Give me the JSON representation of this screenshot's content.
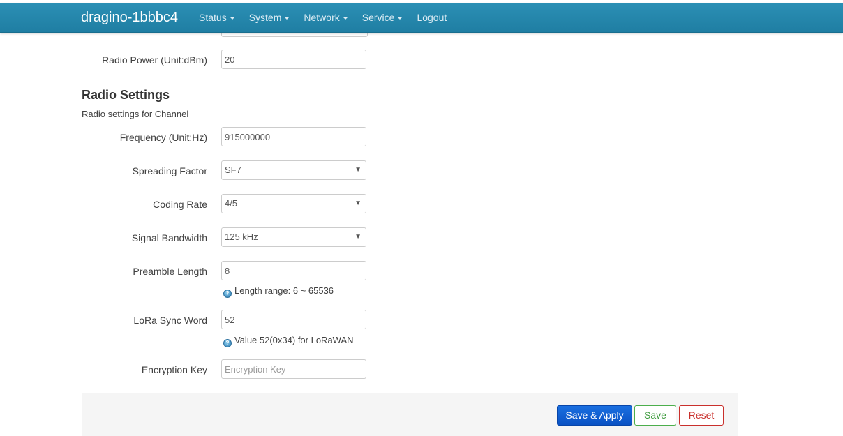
{
  "nav": {
    "brand": "dragino-1bbbc4",
    "menu": [
      {
        "label": "Status",
        "dropdown": true
      },
      {
        "label": "System",
        "dropdown": true
      },
      {
        "label": "Network",
        "dropdown": true
      },
      {
        "label": "Service",
        "dropdown": true
      },
      {
        "label": "Logout",
        "dropdown": false
      }
    ]
  },
  "radio_power": {
    "label": "Radio Power (Unit:dBm)",
    "value": "20"
  },
  "section": {
    "title": "Radio Settings",
    "description": "Radio settings for Channel"
  },
  "fields": {
    "frequency": {
      "label": "Frequency (Unit:Hz)",
      "value": "915000000"
    },
    "spreading_factor": {
      "label": "Spreading Factor",
      "selected": "SF7"
    },
    "coding_rate": {
      "label": "Coding Rate",
      "selected": "4/5"
    },
    "signal_bandwidth": {
      "label": "Signal Bandwidth",
      "selected": "125 kHz"
    },
    "preamble_length": {
      "label": "Preamble Length",
      "value": "8",
      "hint": "Length range: 6 ~ 65536"
    },
    "sync_word": {
      "label": "LoRa Sync Word",
      "value": "52",
      "hint": "Value 52(0x34) for LoRaWAN"
    },
    "encryption_key": {
      "label": "Encryption Key",
      "value": "",
      "placeholder": "Encryption Key"
    }
  },
  "actions": {
    "save_apply": "Save & Apply",
    "save": "Save",
    "reset": "Reset"
  },
  "colors": {
    "navbar": "#2b8fb4",
    "primary_button": "#0a52c4",
    "save_button": "#4cae4c",
    "reset_button": "#c9302c"
  }
}
